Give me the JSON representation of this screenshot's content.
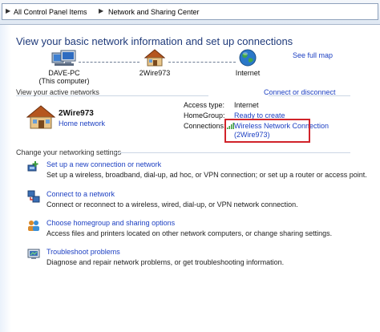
{
  "breadcrumb": {
    "items": [
      "All Control Panel Items",
      "Network and Sharing Center"
    ]
  },
  "header": {
    "title": "View your basic network information and set up connections",
    "see_full_map": "See full map"
  },
  "map": {
    "computer_name": "DAVE-PC",
    "computer_sub": "(This computer)",
    "network_name": "2Wire973",
    "internet": "Internet"
  },
  "active": {
    "heading": "View your active networks",
    "connect_disconnect": "Connect or disconnect",
    "network_name": "2Wire973",
    "network_type": "Home network",
    "access_type_label": "Access type:",
    "access_type_value": "Internet",
    "homegroup_label": "HomeGroup:",
    "homegroup_value": "Ready to create",
    "connections_label": "Connections:",
    "connection_line1": "Wireless Network Connection",
    "connection_line2": "(2Wire973)"
  },
  "settings": {
    "heading": "Change your networking settings",
    "tasks": [
      {
        "link": "Set up a new connection or network",
        "desc": "Set up a wireless, broadband, dial-up, ad hoc, or VPN connection; or set up a router or access point."
      },
      {
        "link": "Connect to a network",
        "desc": "Connect or reconnect to a wireless, wired, dial-up, or VPN network connection."
      },
      {
        "link": "Choose homegroup and sharing options",
        "desc": "Access files and printers located on other network computers, or change sharing settings."
      },
      {
        "link": "Troubleshoot problems",
        "desc": "Diagnose and repair network problems, or get troubleshooting information."
      }
    ]
  },
  "colors": {
    "link": "#1c3fc2",
    "title": "#1f3a7a",
    "highlight_box": "#d1232a"
  }
}
